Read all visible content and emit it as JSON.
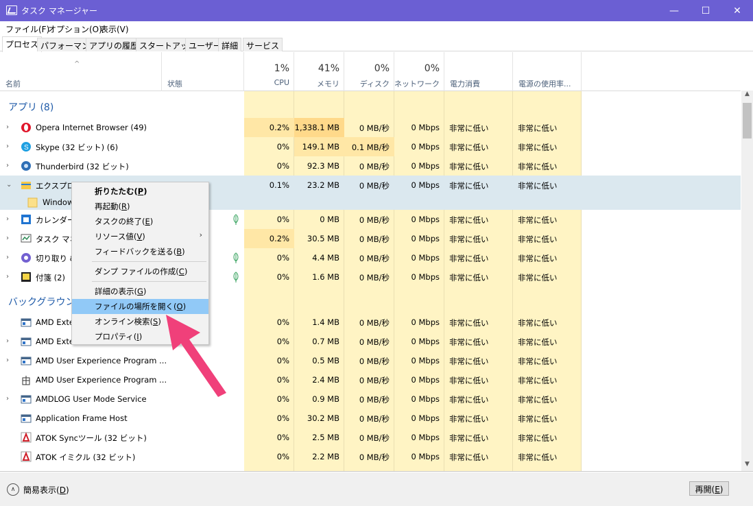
{
  "window": {
    "title": "タスク マネージャー",
    "min": "—",
    "max": "☐",
    "close": "✕"
  },
  "menu": [
    "ファイル(F)",
    "オプション(O)",
    "表示(V)"
  ],
  "tabs": [
    "プロセス",
    "パフォーマンス",
    "アプリの履歴",
    "スタートアップ",
    "ユーザー",
    "詳細",
    "サービス"
  ],
  "header": {
    "name": "名前",
    "status": "状態",
    "cpu_pct": "1%",
    "cpu": "CPU",
    "mem_pct": "41%",
    "mem": "メモリ",
    "disk_pct": "0%",
    "disk": "ディスク",
    "net_pct": "0%",
    "net": "ネットワーク",
    "power": "電力消費",
    "power_trend": "電源の使用率..."
  },
  "groups": {
    "apps": "アプリ (8)",
    "background": "バックグラウンド"
  },
  "rows": [
    {
      "name": "Opera Internet Browser (49)",
      "cpu": "0.2%",
      "mem": "1,338.1 MB",
      "disk": "0 MB/秒",
      "net": "0 Mbps",
      "power": "非常に低い",
      "trend": "非常に低い",
      "icon": "opera-icon"
    },
    {
      "name": "Skype (32 ビット) (6)",
      "cpu": "0%",
      "mem": "149.1 MB",
      "disk": "0.1 MB/秒",
      "net": "0 Mbps",
      "power": "非常に低い",
      "trend": "非常に低い",
      "icon": "skype-icon"
    },
    {
      "name": "Thunderbird (32 ビット)",
      "cpu": "0%",
      "mem": "92.3 MB",
      "disk": "0 MB/秒",
      "net": "0 Mbps",
      "power": "非常に低い",
      "trend": "非常に低い",
      "icon": "thunderbird-icon"
    },
    {
      "name": "エクスプローラー",
      "cpu": "0.1%",
      "mem": "23.2 MB",
      "disk": "0 MB/秒",
      "net": "0 Mbps",
      "power": "非常に低い",
      "trend": "非常に低い",
      "icon": "explorer-icon"
    },
    {
      "name": "Windows",
      "icon": "folder-icon"
    },
    {
      "name": "カレンダー",
      "cpu": "0%",
      "mem": "0 MB",
      "disk": "0 MB/秒",
      "net": "0 Mbps",
      "power": "非常に低い",
      "trend": "非常に低い",
      "icon": "calendar-icon"
    },
    {
      "name": "タスク マネ",
      "cpu": "0.2%",
      "mem": "30.5 MB",
      "disk": "0 MB/秒",
      "net": "0 Mbps",
      "power": "非常に低い",
      "trend": "非常に低い",
      "icon": "taskmgr-icon"
    },
    {
      "name": "切り取り &",
      "cpu": "0%",
      "mem": "4.4 MB",
      "disk": "0 MB/秒",
      "net": "0 Mbps",
      "power": "非常に低い",
      "trend": "非常に低い",
      "icon": "snip-icon"
    },
    {
      "name": "付箋 (2)",
      "cpu": "0%",
      "mem": "1.6 MB",
      "disk": "0 MB/秒",
      "net": "0 Mbps",
      "power": "非常に低い",
      "trend": "非常に低い",
      "icon": "sticky-icon"
    },
    {
      "name": "AMD Exte",
      "cpu": "0%",
      "mem": "1.4 MB",
      "disk": "0 MB/秒",
      "net": "0 Mbps",
      "power": "非常に低い",
      "trend": "非常に低い",
      "icon": "service-icon"
    },
    {
      "name": "AMD Exte",
      "cpu": "0%",
      "mem": "0.7 MB",
      "disk": "0 MB/秒",
      "net": "0 Mbps",
      "power": "非常に低い",
      "trend": "非常に低い",
      "icon": "service-icon"
    },
    {
      "name": "AMD User Experience Program ...",
      "cpu": "0%",
      "mem": "0.5 MB",
      "disk": "0 MB/秒",
      "net": "0 Mbps",
      "power": "非常に低い",
      "trend": "非常に低い",
      "icon": "service-icon"
    },
    {
      "name": "AMD User Experience Program ...",
      "cpu": "0%",
      "mem": "2.4 MB",
      "disk": "0 MB/秒",
      "net": "0 Mbps",
      "power": "非常に低い",
      "trend": "非常に低い",
      "icon": "gift-icon"
    },
    {
      "name": "AMDLOG User Mode Service",
      "cpu": "0%",
      "mem": "0.9 MB",
      "disk": "0 MB/秒",
      "net": "0 Mbps",
      "power": "非常に低い",
      "trend": "非常に低い",
      "icon": "service-icon"
    },
    {
      "name": "Application Frame Host",
      "cpu": "0%",
      "mem": "30.2 MB",
      "disk": "0 MB/秒",
      "net": "0 Mbps",
      "power": "非常に低い",
      "trend": "非常に低い",
      "icon": "service-icon"
    },
    {
      "name": "ATOK Syncツール (32 ビット)",
      "cpu": "0%",
      "mem": "2.5 MB",
      "disk": "0 MB/秒",
      "net": "0 Mbps",
      "power": "非常に低い",
      "trend": "非常に低い",
      "icon": "atok-icon"
    },
    {
      "name": "ATOK イミクル (32 ビット)",
      "cpu": "0%",
      "mem": "2.2 MB",
      "disk": "0 MB/秒",
      "net": "0 Mbps",
      "power": "非常に低い",
      "trend": "非常に低い",
      "icon": "atok-icon"
    }
  ],
  "context_menu": [
    {
      "text": "折りたたむ(",
      "key": "P",
      "end": ")"
    },
    {
      "text": "再起動(",
      "key": "R",
      "end": ")"
    },
    {
      "text": "タスクの終了(",
      "key": "E",
      "end": ")"
    },
    {
      "text": "リソース値(",
      "key": "V",
      "end": ")",
      "submenu": "›"
    },
    {
      "text": "フィードバックを送る(",
      "key": "B",
      "end": ")"
    },
    {
      "text": "ダンプ ファイルの作成(",
      "key": "C",
      "end": ")"
    },
    {
      "text": "詳細の表示(",
      "key": "G",
      "end": ")"
    },
    {
      "text": "ファイルの場所を開く(",
      "key": "O",
      "end": ")"
    },
    {
      "text": "オンライン検索(",
      "key": "S",
      "end": ")"
    },
    {
      "text": "プロパティ(",
      "key": "I",
      "end": ")"
    }
  ],
  "footer": {
    "collapse_icon": "∧",
    "collapse_text": "簡易表示(",
    "collapse_key": "D",
    "collapse_end": ")",
    "restart_text": "再開(",
    "restart_key": "E",
    "restart_end": ")"
  },
  "colors": {
    "titlebar": "#6b5fd3",
    "highlight": "#91c9f7",
    "heat": "#fff4c4",
    "arrow": "#f0407a"
  }
}
